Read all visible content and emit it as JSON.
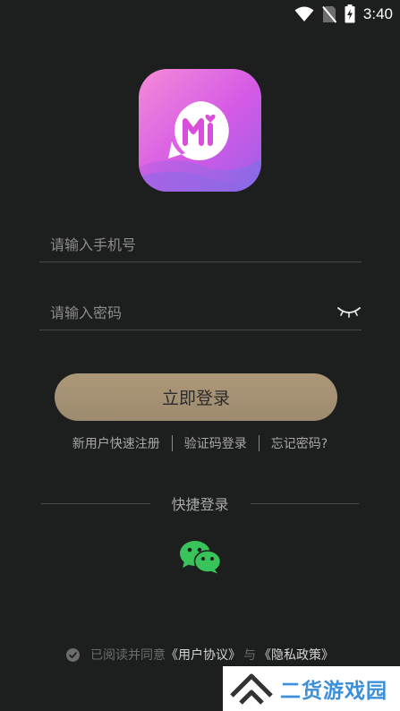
{
  "status_bar": {
    "time": "3:40",
    "icons": [
      "wifi-icon",
      "no-sim-icon",
      "battery-charging-icon"
    ]
  },
  "app": {
    "logo_icon": "app-logo-icon",
    "brand_colors": [
      "#f27fd7",
      "#c94ee6",
      "#8b6ae3"
    ]
  },
  "form": {
    "phone_placeholder": "请输入手机号",
    "phone_value": "",
    "password_placeholder": "请输入密码",
    "password_value": "",
    "password_toggle_icon": "eye-closed-icon",
    "login_label": "立即登录",
    "login_color": "#a8927a"
  },
  "links": {
    "register": "新用户快速注册",
    "sms_login": "验证码登录",
    "forgot": "忘记密码?"
  },
  "quick_login": {
    "label": "快捷登录",
    "wechat_icon": "wechat-icon",
    "wechat_color": "#38c45b"
  },
  "agreement": {
    "prefix": "已阅读并同意",
    "user_agreement": "《用户协议》",
    "and": "与",
    "privacy_policy": "《隐私政策》",
    "checked": true
  },
  "watermark": {
    "text": "二货游戏园"
  }
}
